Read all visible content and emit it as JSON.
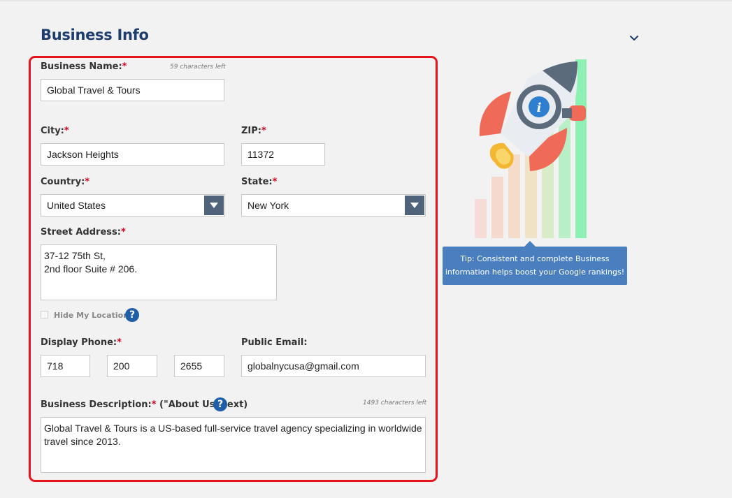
{
  "section": {
    "title": "Business Info"
  },
  "form": {
    "business_name": {
      "label": "Business Name:",
      "required": "*",
      "counter": "59 characters left",
      "value": "Global Travel & Tours"
    },
    "city": {
      "label": "City:",
      "required": "*",
      "value": "Jackson Heights"
    },
    "zip": {
      "label": "ZIP:",
      "required": "*",
      "value": "11372"
    },
    "country": {
      "label": "Country:",
      "required": "*",
      "value": "United States"
    },
    "state": {
      "label": "State:",
      "required": "*",
      "value": "New York"
    },
    "street": {
      "label": "Street Address:",
      "required": "*",
      "value": "37-12 75th St,\n2nd floor Suite # 206."
    },
    "hide_location": {
      "label": "Hide My Location",
      "checked": false
    },
    "phone": {
      "label": "Display Phone:",
      "required": "*",
      "part1": "718",
      "part2": "200",
      "part3": "2655"
    },
    "email": {
      "label": "Public Email:",
      "value": "globalnycusa@gmail.com"
    },
    "description": {
      "label": "Business Description:",
      "required": "*",
      "label_suffix": " (\"About Us\" text)",
      "counter": "1493 characters left",
      "value": "Global Travel & Tours is a US-based full-service travel agency specializing in worldwide travel since 2013."
    }
  },
  "tip": {
    "line1": "Tip: Consistent and complete Business",
    "line2": "information helps boost your Google rankings!"
  },
  "icons": {
    "help": "?",
    "collapse": "chevron-down-icon",
    "dropdown": "triangle-down-icon",
    "illustration": "rocket-info-icon"
  },
  "colors": {
    "title": "#1e3c6e",
    "highlight_border": "#e8141b",
    "required": "#d0021b",
    "select_arrow_bg": "#4f637a",
    "help_icon": "#1f5fa8",
    "tip_bg": "#4a7fbf"
  }
}
